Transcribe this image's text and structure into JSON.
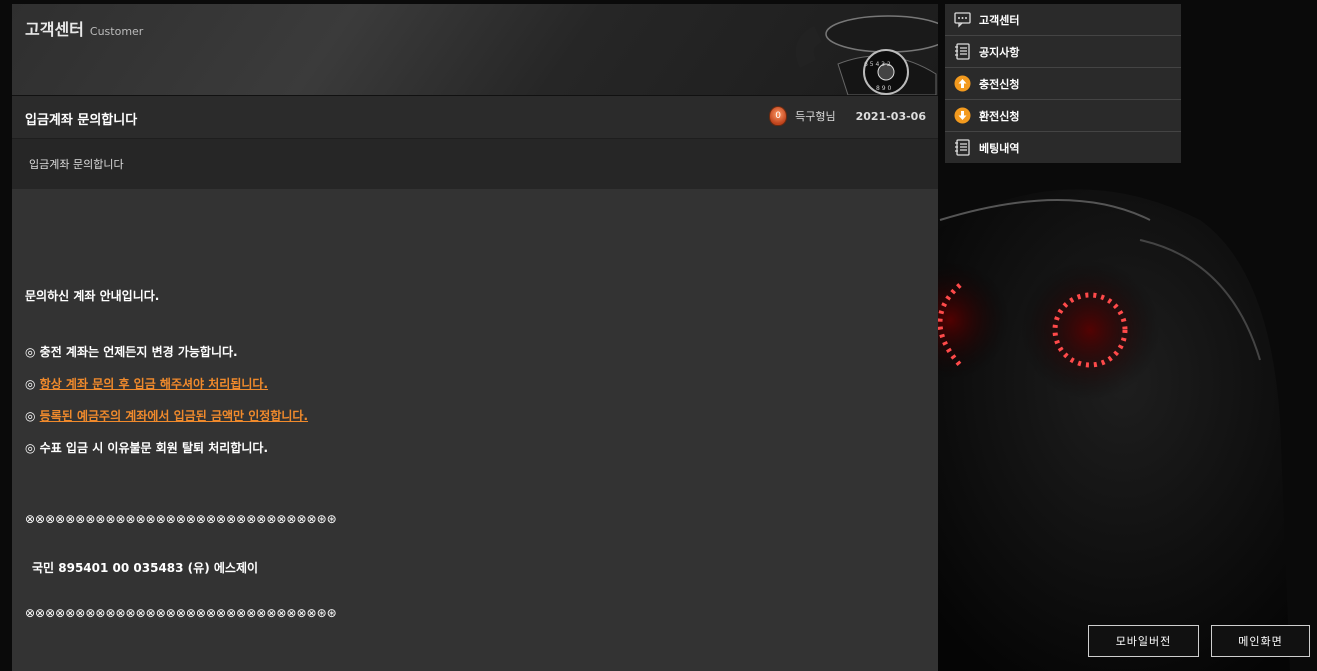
{
  "header": {
    "title": "고객센터",
    "subtitle": "Customer"
  },
  "post": {
    "title": "입금계좌 문의합니다",
    "author_level": "0",
    "author": "득구형님",
    "date": "2021-03-06",
    "question": "입금계좌 문의합니다"
  },
  "answer": {
    "intro": "문의하신 계좌 안내입니다.",
    "lines": [
      {
        "bullet": "◎",
        "text": "충전 계좌는 언제든지 변경 가능합니다."
      },
      {
        "bullet": "◎",
        "text": "항상 계좌 문의 후 입금 해주셔야 처리됩니다."
      },
      {
        "bullet": "◎",
        "text": "등록된 예금주의 계좌에서 입금된 금액만 인정합니다."
      },
      {
        "bullet": "◎",
        "text": "수표 입금 시 이유불문 회원 탈퇴 처리합니다."
      }
    ],
    "separator": "⊗⊗⊗⊗⊗⊗⊗⊗⊗⊗⊗⊗⊗⊗⊗⊗⊗⊗⊗⊗⊗⊗⊗⊗⊗⊗⊗⊗⊗⊛⊛",
    "account": "국민  895401 00 035483  (유) 에스제이"
  },
  "menu": {
    "items": [
      {
        "label": "고객센터",
        "icon": "chat-icon"
      },
      {
        "label": "공지사항",
        "icon": "notebook-icon"
      },
      {
        "label": "충전신청",
        "icon": "arrow-up-icon"
      },
      {
        "label": "환전신청",
        "icon": "arrow-down-icon"
      },
      {
        "label": "베팅내역",
        "icon": "notebook-icon"
      }
    ]
  },
  "buttons": {
    "mobile": "모바일버전",
    "main": "메인화면"
  },
  "colors": {
    "accent": "#f08a2c",
    "panel": "#333333",
    "menu": "#2a2a2a"
  }
}
